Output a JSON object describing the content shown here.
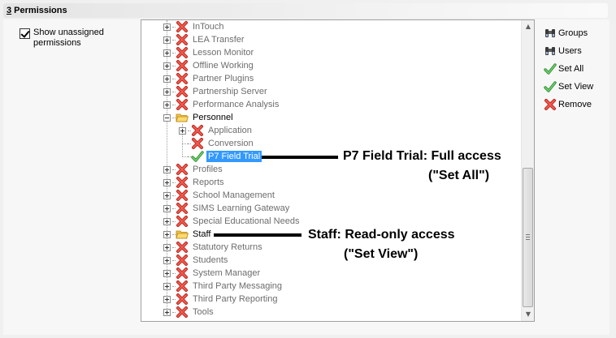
{
  "section": {
    "number": "3",
    "title": " Permissions"
  },
  "checkbox": {
    "label": "Show unassigned permissions",
    "checked": true
  },
  "tree": {
    "items": [
      {
        "label": "InTouch",
        "icon": "cross-icon"
      },
      {
        "label": "LEA Transfer",
        "icon": "cross-icon"
      },
      {
        "label": "Lesson Monitor",
        "icon": "cross-icon"
      },
      {
        "label": "Offline Working",
        "icon": "cross-icon"
      },
      {
        "label": "Partner Plugins",
        "icon": "cross-icon"
      },
      {
        "label": "Partnership Server",
        "icon": "cross-icon"
      },
      {
        "label": "Performance Analysis",
        "icon": "cross-icon"
      },
      {
        "label": "Personnel",
        "icon": "folder-icon"
      },
      {
        "label": "Application",
        "icon": "cross-icon"
      },
      {
        "label": "Conversion",
        "icon": "cross-icon"
      },
      {
        "label": "P7 Field Trial",
        "icon": "check-icon",
        "selected": true
      },
      {
        "label": "Profiles",
        "icon": "cross-icon"
      },
      {
        "label": "Reports",
        "icon": "cross-icon"
      },
      {
        "label": "School Management",
        "icon": "cross-icon"
      },
      {
        "label": "SIMS Learning Gateway",
        "icon": "cross-icon"
      },
      {
        "label": "Special Educational Needs",
        "icon": "cross-icon"
      },
      {
        "label": "Staff",
        "icon": "folder-icon"
      },
      {
        "label": "Statutory Returns",
        "icon": "cross-icon"
      },
      {
        "label": "Students",
        "icon": "cross-icon"
      },
      {
        "label": "System Manager",
        "icon": "cross-icon"
      },
      {
        "label": "Third Party Messaging",
        "icon": "cross-icon"
      },
      {
        "label": "Third Party Reporting",
        "icon": "cross-icon"
      },
      {
        "label": "Tools",
        "icon": "cross-icon"
      }
    ]
  },
  "toolbar": {
    "groups": {
      "label": "Groups",
      "icon": "binoculars-icon"
    },
    "users": {
      "label": "Users",
      "icon": "binoculars-icon"
    },
    "set_all": {
      "label": "Set All",
      "icon": "check-icon"
    },
    "set_view": {
      "label": "Set View",
      "icon": "check-icon"
    },
    "remove": {
      "label": "Remove",
      "icon": "cross-icon"
    }
  },
  "annotations": {
    "p7": {
      "line1": "P7 Field Trial: Full access",
      "line2": "(\"Set All\")"
    },
    "staff": {
      "line1": "Staff: Read-only access",
      "line2": "(\"Set View\")"
    }
  },
  "colors": {
    "cross": "#e03a2e",
    "check": "#3aa83a",
    "folder": "#f0b429",
    "selection": "#3399ff"
  }
}
